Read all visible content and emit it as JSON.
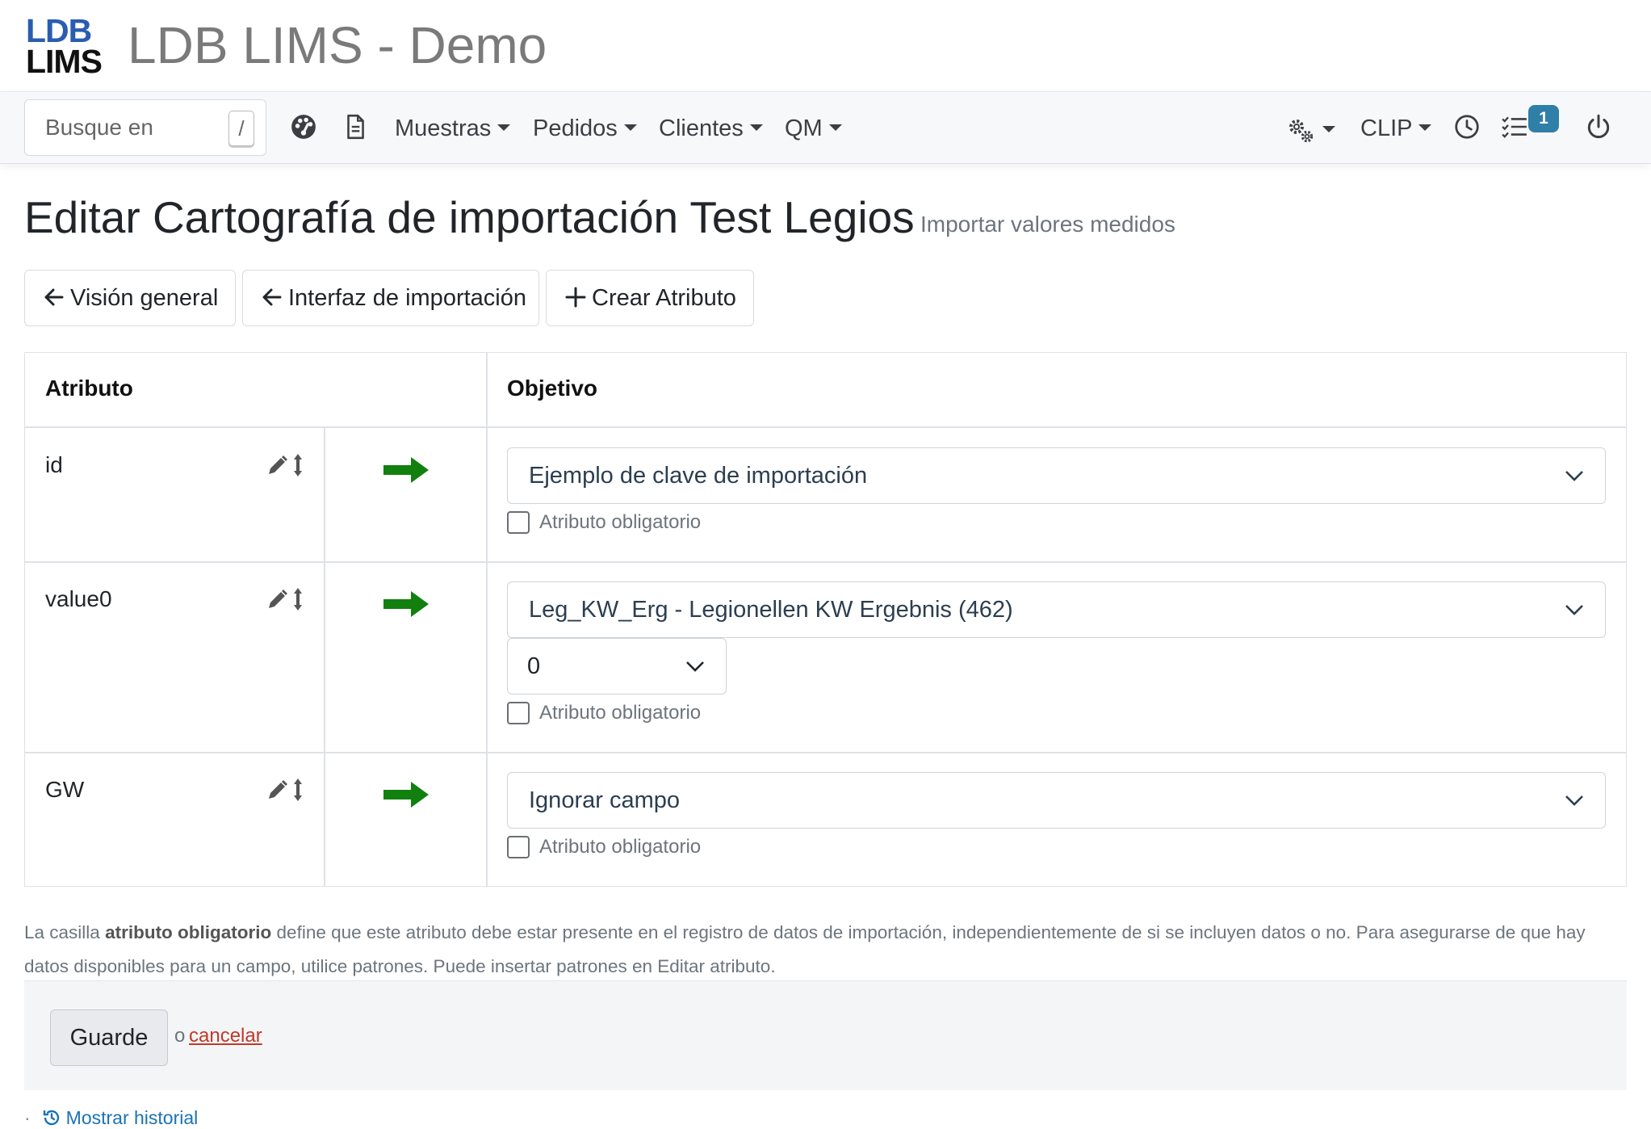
{
  "app": {
    "logo_line1": "LDB",
    "logo_line2": "LIMS",
    "title": "LDB LIMS - Demo"
  },
  "navbar": {
    "search_placeholder": "Busque en",
    "search_shortcut": "/",
    "menus": [
      "Muestras",
      "Pedidos",
      "Clientes",
      "QM"
    ],
    "user_menu": "CLIP",
    "tasks_badge": "1"
  },
  "page": {
    "title": "Editar Cartografía de importación Test Legios",
    "subtitle": "Importar valores medidos"
  },
  "actions": {
    "overview": "Visión general",
    "import_interface": "Interfaz de importación",
    "create_attribute": "Crear Atributo"
  },
  "table": {
    "headers": {
      "attribute": "Atributo",
      "target": "Objetivo"
    },
    "rows": [
      {
        "attribute": "id",
        "target": "Ejemplo de clave de importación",
        "sub_select": null,
        "required_label": "Atributo obligatorio",
        "required": false
      },
      {
        "attribute": "value0",
        "target": "Leg_KW_Erg - Legionellen KW Ergebnis (462)",
        "sub_select": "0",
        "required_label": "Atributo obligatorio",
        "required": false
      },
      {
        "attribute": "GW",
        "target": "Ignorar campo",
        "sub_select": null,
        "required_label": "Atributo obligatorio",
        "required": false
      }
    ]
  },
  "help": {
    "prefix": "La casilla ",
    "bold": "atributo obligatorio",
    "suffix": " define que este atributo debe estar presente en el registro de datos de importación, independientemente de si se incluyen datos o no. Para asegurarse de que hay datos disponibles para un campo, utilice patrones. Puede insertar patrones en Editar atributo."
  },
  "form": {
    "save_label": "Guarde",
    "or_text": "o",
    "cancel_label": "cancelar"
  },
  "history": {
    "bullet": "·",
    "label": "Mostrar historial"
  },
  "colors": {
    "arrow_green": "#12800f",
    "logo_blue": "#2a5db0",
    "badge_blue": "#2f7fa8",
    "link_blue": "#1a73b5",
    "cancel_red": "#c0392b"
  }
}
